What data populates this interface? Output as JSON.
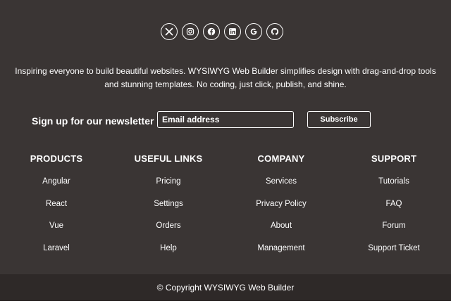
{
  "socials": [
    {
      "icon": "x-icon",
      "label": "X"
    },
    {
      "icon": "instagram-icon",
      "label": "Instagram"
    },
    {
      "icon": "facebook-icon",
      "label": "Facebook"
    },
    {
      "icon": "linkedin-icon",
      "label": "LinkedIn"
    },
    {
      "icon": "google-icon",
      "label": "Google"
    },
    {
      "icon": "github-icon",
      "label": "GitHub"
    }
  ],
  "tagline": "Inspiring everyone to build beautiful websites. WYSIWYG Web Builder simplifies design with drag-and-drop tools and stunning templates. No coding, just click, publish, and shine.",
  "newsletter": {
    "label": "Sign up for our newsletter",
    "placeholder": "Email address",
    "button": "Subscribe"
  },
  "columns": [
    {
      "title": "PRODUCTS",
      "links": [
        "Angular",
        "React",
        "Vue",
        "Laravel"
      ]
    },
    {
      "title": "USEFUL LINKS",
      "links": [
        "Pricing",
        "Settings",
        "Orders",
        "Help"
      ]
    },
    {
      "title": "COMPANY",
      "links": [
        "Services",
        "Privacy Policy",
        "About",
        "Management"
      ]
    },
    {
      "title": "SUPPORT",
      "links": [
        "Tutorials",
        "FAQ",
        "Forum",
        "Support Ticket"
      ]
    }
  ],
  "copyright": "© Copyright WYSIWYG Web Builder",
  "colors": {
    "footer_bg": "#3a3534",
    "bottom_bg": "#2e2928",
    "text": "#ffffff"
  }
}
